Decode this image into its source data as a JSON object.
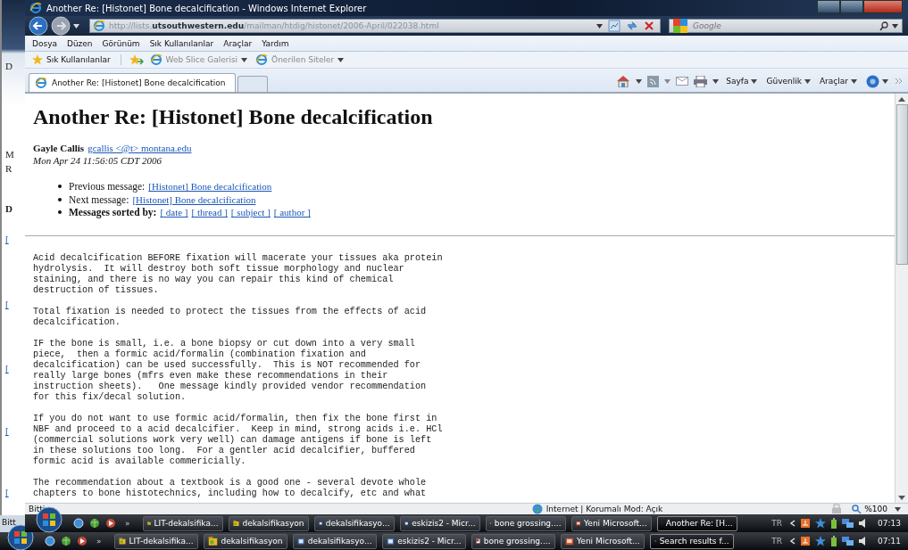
{
  "background_screen": {
    "edge_texts": [
      {
        "kind": "text",
        "text": "D"
      },
      {
        "kind": "text",
        "text": "M"
      },
      {
        "kind": "text",
        "text": "R"
      },
      {
        "kind": "heading",
        "text": "D"
      },
      {
        "kind": "link",
        "text": "["
      },
      {
        "kind": "link",
        "text": "["
      },
      {
        "kind": "link",
        "text": "["
      },
      {
        "kind": "link",
        "text": "["
      },
      {
        "kind": "link",
        "text": "["
      }
    ],
    "status_text": "Bitt",
    "taskbar": {
      "overflow": "»",
      "items": [
        {
          "label": "LIT-dekalsifika...",
          "kind": "folder",
          "selected": false
        },
        {
          "label": "dekalsifikasyon",
          "kind": "folder",
          "selected": false
        },
        {
          "label": "dekalsifikasyo...",
          "kind": "document",
          "selected": false
        },
        {
          "label": "eskizis2 - Micr...",
          "kind": "document",
          "selected": false
        },
        {
          "label": "bone grossing....",
          "kind": "pdf",
          "selected": false
        },
        {
          "label": "Yeni Microsoft...",
          "kind": "slides",
          "selected": false
        },
        {
          "label": "Search results f...",
          "kind": "browser",
          "selected": true
        }
      ],
      "language": "TR",
      "clock": "07:11"
    }
  },
  "window": {
    "title": "Another Re: [Histonet] Bone decalcification - Windows Internet Explorer",
    "address": "http://lists.**utsouthwestern.edu**/mailman/htdig/histonet/2006-April/022038.html",
    "search": {
      "placeholder": "Google"
    },
    "menu": [
      "Dosya",
      "Düzen",
      "Görünüm",
      "Sık Kullanılanlar",
      "Araçlar",
      "Yardım"
    ],
    "favorites_bar": {
      "favorites": "Sık Kullanılanlar",
      "links": [
        "Web Slice Galerisi",
        "Önerilen Siteler"
      ]
    },
    "tabs": [
      {
        "label": "Another Re: [Histonet] Bone decalcification",
        "selected": true
      },
      {
        "selected": false
      }
    ],
    "command_bar": [
      "Sayfa",
      "Güvenlik",
      "Araçlar"
    ],
    "page": {
      "heading": "Another Re: [Histonet] Bone decalcification",
      "author": "Gayle Callis",
      "email": "gcallis <@t> montana.edu",
      "date": "Mon Apr 24 11:56:05 CDT 2006",
      "nav": [
        {
          "label": "Previous message:",
          "links": [
            "[Histonet] Bone decalcification"
          ],
          "bold": false
        },
        {
          "label": "Next message:",
          "links": [
            "[Histonet] Bone decalcification"
          ],
          "bold": false
        },
        {
          "label": "Messages sorted by:",
          "links": [
            "[ date ]",
            "[ thread ]",
            "[ subject ]",
            "[ author ]"
          ],
          "bold": true
        }
      ],
      "body": [
        "Acid decalcification BEFORE fixation will macerate your tissues aka protein\nhydrolysis.  It will destroy both soft tissue morphology and nuclear\nstaining, and there is no way you can repair this kind of chemical\ndestruction of tissues.",
        "Total fixation is needed to protect the tissues from the effects of acid\ndecalcification.",
        "IF the bone is small, i.e. a bone biopsy or cut down into a very small\npiece,  then a formic acid/formalin (combination fixation and\ndecalcification) can be used successfully.  This is NOT recommended for\nreally large bones (mfrs even make these recommendations in their\ninstruction sheets).   One message kindly provided vendor recommendation\nfor this fix/decal solution.",
        "If you do not want to use formic acid/formalin, then fix the bone first in\nNBF and proceed to a acid decalcifier.  Keep in mind, strong acids i.e. HCl\n(commercial solutions work very well) can damage antigens if bone is left\nin these solutions too long.  For a gentler acid decalcifier, buffered\nformic acid is available commericially.",
        "The recommendation about a textbook is a good one - several devote whole\nchapters to bone histotechnics, including how to decalcify, etc and what"
      ]
    },
    "status_bar": {
      "text": "Bitti",
      "zone": "Internet | Korumalı Mod: Açık",
      "zoom": "%100"
    },
    "taskbar": {
      "overflow": "»",
      "items": [
        {
          "label": "LIT-dekalsifika...",
          "kind": "folder",
          "selected": false
        },
        {
          "label": "dekalsifikasyon",
          "kind": "folder",
          "selected": false
        },
        {
          "label": "dekalsifikasyo...",
          "kind": "document",
          "selected": false
        },
        {
          "label": "eskizis2 - Micr...",
          "kind": "document",
          "selected": false
        },
        {
          "label": "bone grossing....",
          "kind": "pdf",
          "selected": false
        },
        {
          "label": "Yeni Microsoft...",
          "kind": "slides",
          "selected": false
        },
        {
          "label": "Another Re: [H...",
          "kind": "browser",
          "selected": true
        }
      ],
      "language": "TR",
      "clock": "07:13"
    }
  }
}
